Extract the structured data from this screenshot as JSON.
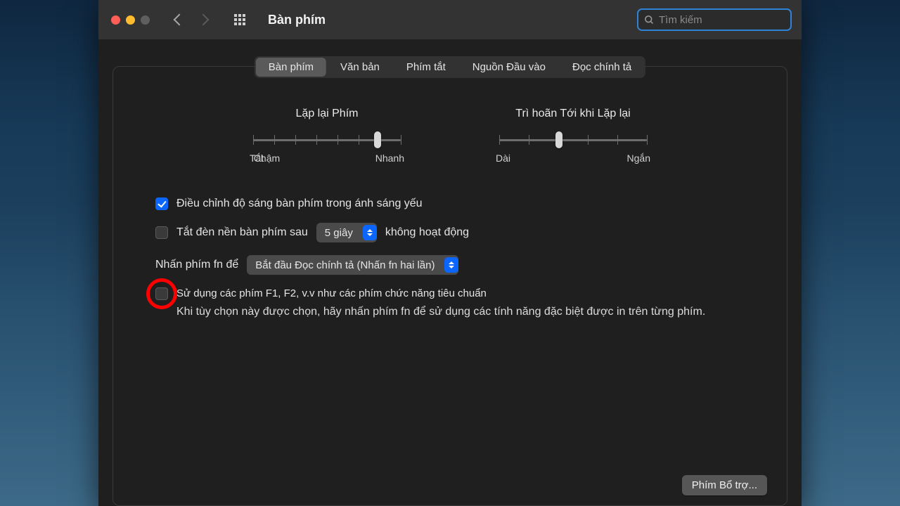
{
  "toolbar": {
    "title": "Bàn phím",
    "search_placeholder": "Tìm kiếm"
  },
  "tabs": {
    "keyboard": "Bàn phím",
    "text": "Văn bản",
    "shortcuts": "Phím tắt",
    "input": "Nguồn Đầu vào",
    "dictation": "Đọc chính tả"
  },
  "sliders": {
    "repeat": {
      "title": "Lặp lại Phím",
      "off": "Tắt",
      "slow": "Chậm",
      "fast": "Nhanh"
    },
    "delay": {
      "title": "Trì hoãn Tới khi Lặp lại",
      "long": "Dài",
      "short": "Ngắn"
    }
  },
  "options": {
    "adjust_brightness": "Điều chỉnh độ sáng bàn phím trong ánh sáng yếu",
    "backlight_pre": "Tắt đèn nền bàn phím sau",
    "backlight_value": "5 giây",
    "backlight_post": "không hoạt động",
    "fn_label": "Nhấn phím fn để",
    "fn_value": "Bắt đầu Đọc chính tả (Nhấn fn hai lần)",
    "use_fkeys": "Sử dụng các phím F1, F2, v.v như các phím chức năng tiêu chuẩn",
    "use_fkeys_desc": "Khi tùy chọn này được chọn, hãy nhấn phím fn để sử dụng các tính năng đặc biệt được in trên từng phím."
  },
  "modifier_button": "Phím Bổ trợ..."
}
